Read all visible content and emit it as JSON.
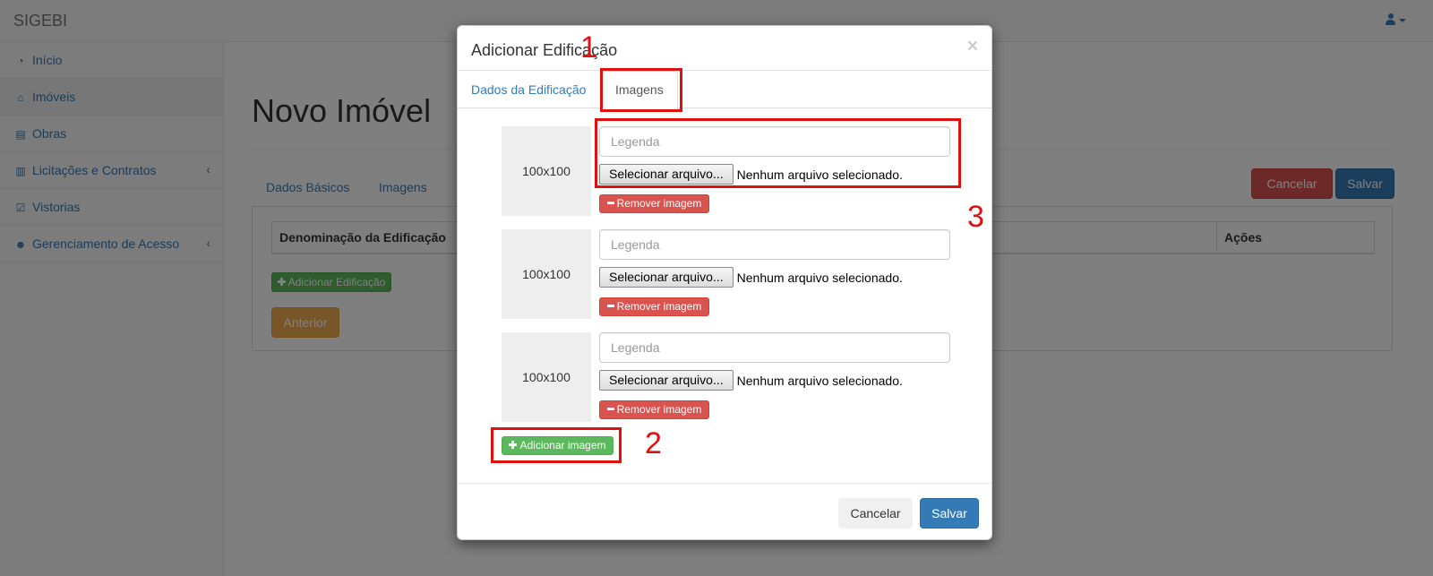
{
  "app": {
    "brand": "SIGEBI"
  },
  "sidebar": {
    "items": [
      {
        "label": "Início",
        "icon": "dashboard-icon",
        "glyph": "◔"
      },
      {
        "label": "Imóveis",
        "icon": "home-icon",
        "glyph": "⌂"
      },
      {
        "label": "Obras",
        "icon": "building-icon",
        "glyph": "▤"
      },
      {
        "label": "Licitações e Contratos",
        "icon": "book-icon",
        "glyph": "▥",
        "arrow": "‹"
      },
      {
        "label": "Vistorias",
        "icon": "check-square-icon",
        "glyph": "☑"
      },
      {
        "label": "Gerenciamento de Acesso",
        "icon": "users-icon",
        "glyph": "☻",
        "arrow": "‹"
      }
    ]
  },
  "page": {
    "title": "Novo Imóvel",
    "tabs": [
      "Dados Básicos",
      "Imagens"
    ],
    "cancel_label": "Cancelar",
    "save_label": "Salvar",
    "table": {
      "col_name": "Denominação da Edificação",
      "col_actions": "Ações"
    },
    "add_building_label": "Adicionar Edificação",
    "prev_label": "Anterior"
  },
  "modal": {
    "title": "Adicionar Edificação",
    "close": "×",
    "tabs": [
      "Dados da Edificação",
      "Imagens"
    ],
    "images": [
      {
        "thumb": "100x100",
        "caption_placeholder": "Legenda",
        "file_button": "Selecionar arquivo...",
        "file_status": "Nenhum arquivo selecionado.",
        "remove_label": "Remover imagem"
      },
      {
        "thumb": "100x100",
        "caption_placeholder": "Legenda",
        "file_button": "Selecionar arquivo...",
        "file_status": "Nenhum arquivo selecionado.",
        "remove_label": "Remover imagem"
      },
      {
        "thumb": "100x100",
        "caption_placeholder": "Legenda",
        "file_button": "Selecionar arquivo...",
        "file_status": "Nenhum arquivo selecionado.",
        "remove_label": "Remover imagem"
      }
    ],
    "add_image_label": "Adicionar imagem",
    "cancel_label": "Cancelar",
    "save_label": "Salvar"
  },
  "annotations": [
    "1",
    "2",
    "3"
  ],
  "colors": {
    "annotation_red": "#e01010",
    "primary": "#337ab7",
    "danger": "#d9534f",
    "success": "#5cb85c",
    "warning": "#f0ad4e"
  }
}
